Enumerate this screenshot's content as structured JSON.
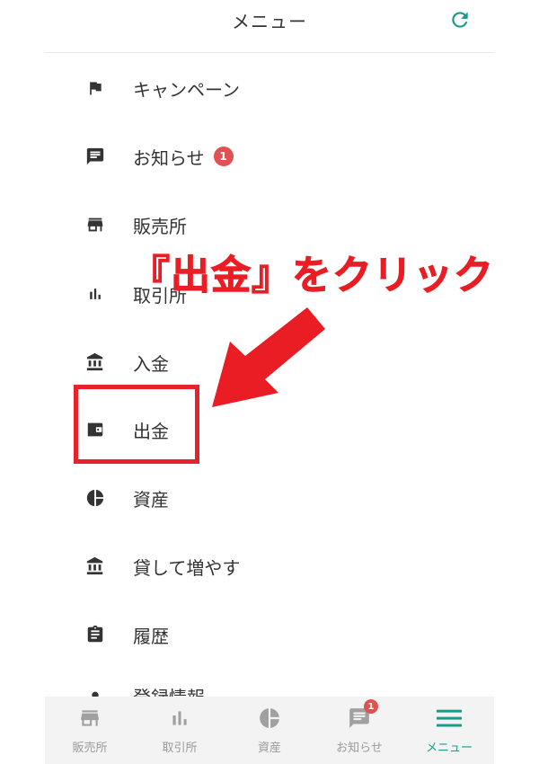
{
  "header": {
    "title": "メニュー",
    "refresh_icon": "refresh-icon"
  },
  "menu": {
    "items": [
      {
        "label": "キャンペーン",
        "icon": "flag-icon"
      },
      {
        "label": "お知らせ",
        "icon": "message-icon",
        "badge": "1"
      },
      {
        "label": "販売所",
        "icon": "store-icon"
      },
      {
        "label": "取引所",
        "icon": "bar-chart-icon"
      },
      {
        "label": "入金",
        "icon": "bank-icon"
      },
      {
        "label": "出金",
        "icon": "wallet-icon"
      },
      {
        "label": "資産",
        "icon": "pie-chart-icon"
      },
      {
        "label": "貸して増やす",
        "icon": "bank-icon"
      },
      {
        "label": "履歴",
        "icon": "clipboard-icon"
      },
      {
        "label": "登録情報",
        "icon": "account-icon"
      }
    ]
  },
  "annotation": {
    "text": "『出金』をクリック"
  },
  "bottom_nav": {
    "items": [
      {
        "label": "販売所",
        "icon": "store-icon"
      },
      {
        "label": "取引所",
        "icon": "bar-chart-icon"
      },
      {
        "label": "資産",
        "icon": "pie-chart-icon"
      },
      {
        "label": "お知らせ",
        "icon": "message-icon",
        "badge": "1"
      },
      {
        "label": "メニュー",
        "icon": "menu-icon",
        "active": true
      }
    ]
  },
  "colors": {
    "accent": "#1a9b8a",
    "annotation_red": "#ea1c24",
    "badge_red": "#e05252",
    "icon_dark": "#333333",
    "nav_grey": "#9a9a9a"
  }
}
